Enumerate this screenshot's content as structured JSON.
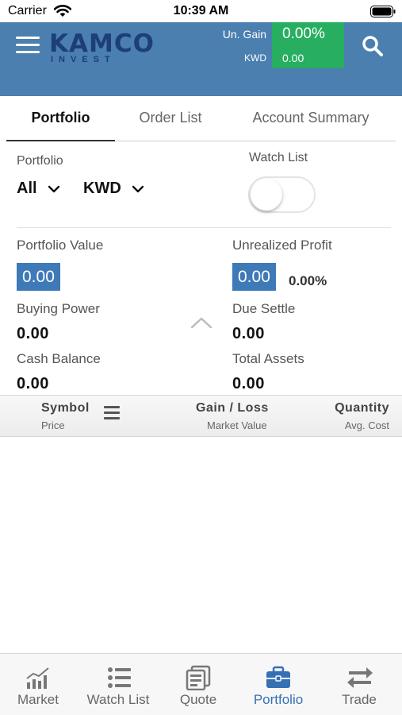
{
  "status_bar": {
    "carrier": "Carrier",
    "time": "10:39 AM"
  },
  "header": {
    "logo_main": "KAMCO",
    "logo_sub": "INVEST",
    "gain_label": "Un. Gain",
    "gain_pct": "0.00%",
    "gain_currency": "KWD",
    "gain_value": "0.00",
    "colors": {
      "header_bg": "#4a7fb0",
      "gain_box": "#27ae60",
      "logo": "#1d3e78"
    }
  },
  "tabs": [
    {
      "label": "Portfolio",
      "active": true
    },
    {
      "label": "Order List",
      "active": false
    },
    {
      "label": "Account Summary",
      "active": false
    }
  ],
  "filters": {
    "portfolio_label": "Portfolio",
    "portfolio_value": "All",
    "currency_value": "KWD",
    "watch_list_label": "Watch List",
    "watch_list_on": false
  },
  "summary": {
    "portfolio_value_label": "Portfolio Value",
    "portfolio_value": "0.00",
    "unrealized_profit_label": "Unrealized Profit",
    "unrealized_profit": "0.00",
    "unrealized_profit_pct": "0.00%",
    "buying_power_label": "Buying Power",
    "buying_power": "0.00",
    "due_settle_label": "Due Settle",
    "due_settle": "0.00",
    "cash_balance_label": "Cash Balance",
    "cash_balance": "0.00",
    "total_assets_label": "Total Assets",
    "total_assets": "0.00"
  },
  "table_header": {
    "col1_main": "Symbol",
    "col1_sub": "Price",
    "col2_main": "Gain / Loss",
    "col2_sub": "Market Value",
    "col3_main": "Quantity",
    "col3_sub": "Avg. Cost"
  },
  "bottom_nav": [
    {
      "label": "Market",
      "icon": "bar-chart-icon",
      "active": false
    },
    {
      "label": "Watch List",
      "icon": "list-icon",
      "active": false
    },
    {
      "label": "Quote",
      "icon": "quote-icon",
      "active": false
    },
    {
      "label": "Portfolio",
      "icon": "briefcase-icon",
      "active": true
    },
    {
      "label": "Trade",
      "icon": "swap-arrows-icon",
      "active": false
    }
  ]
}
